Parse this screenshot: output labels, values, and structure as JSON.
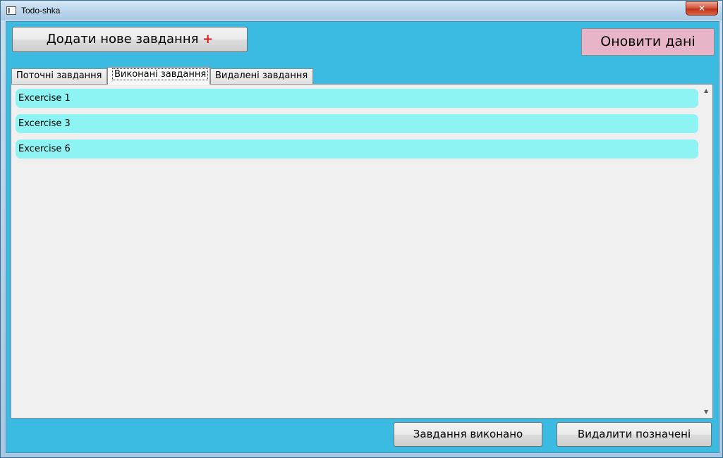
{
  "window": {
    "title": "Todo-shka",
    "close_label": "✕"
  },
  "toolbar": {
    "add_label": "Додати нове завдання",
    "add_plus": "+",
    "refresh_label": "Оновити дані"
  },
  "tabs": [
    {
      "label": "Поточні завдання",
      "active": false
    },
    {
      "label": "Виконані завдання",
      "active": true
    },
    {
      "label": "Видалені завдання",
      "active": false
    }
  ],
  "tasks": [
    {
      "label": "Excercise 1"
    },
    {
      "label": "Excercise 3"
    },
    {
      "label": "Excercise 6"
    }
  ],
  "scrollbar": {
    "up_icon": "▲",
    "down_icon": "▼"
  },
  "actions": {
    "done_label": "Завдання виконано",
    "delete_label": "Видалити позначені"
  }
}
